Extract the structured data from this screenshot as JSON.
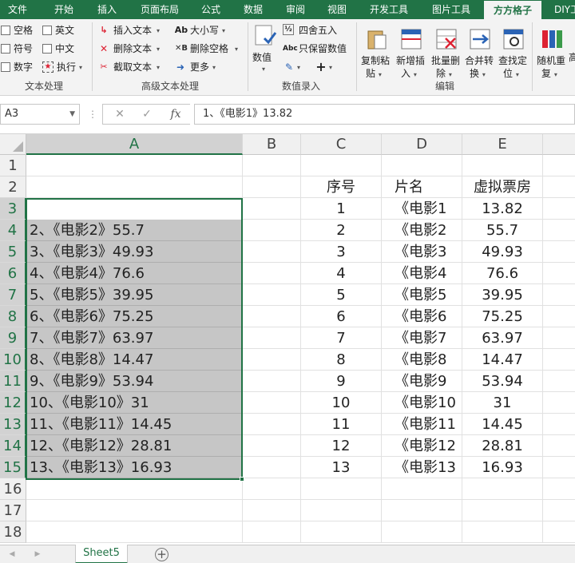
{
  "ribbon_tabs": [
    {
      "label": "文件"
    },
    {
      "label": "开始"
    },
    {
      "label": "插入"
    },
    {
      "label": "页面布局"
    },
    {
      "label": "公式"
    },
    {
      "label": "数据"
    },
    {
      "label": "审阅"
    },
    {
      "label": "视图"
    },
    {
      "label": "开发工具"
    },
    {
      "label": "图片工具"
    },
    {
      "label": "方方格子"
    },
    {
      "label": "DIY工"
    }
  ],
  "active_tab": "方方格子",
  "ribbon": {
    "text_processing": {
      "options": [
        "空格",
        "英文",
        "符号",
        "中文",
        "数字"
      ],
      "execute_label": "执行",
      "group_label": "文本处理"
    },
    "advanced_text": {
      "insert_text": "插入文本",
      "delete_text": "删除文本",
      "extract_text": "截取文本",
      "case_label": "大小写",
      "delete_spaces": "删除空格",
      "more": "更多",
      "group_label": "高级文本处理"
    },
    "numeric_entry": {
      "value_label": "数值",
      "round_label": "四舍五入",
      "keep_values": "只保留数值",
      "group_label": "数值录入"
    },
    "editing": {
      "buttons": [
        {
          "line1": "复制粘",
          "line2": "贴"
        },
        {
          "line1": "新增插",
          "line2": "入"
        },
        {
          "line1": "批量删",
          "line2": "除"
        },
        {
          "line1": "合并转",
          "line2": "换"
        },
        {
          "line1": "查找定",
          "line2": "位"
        }
      ],
      "group_label": "编辑"
    },
    "random": {
      "line1": "随机重",
      "line2": "复"
    },
    "cut_label": "高"
  },
  "formula_bar": {
    "name_box": "A3",
    "cancel_symbol": "✕",
    "enter_symbol": "✓",
    "fx_symbol": "fx",
    "content": "1、《电影1》13.82"
  },
  "columns": [
    {
      "letter": "A"
    },
    {
      "letter": "B"
    },
    {
      "letter": "C"
    },
    {
      "letter": "D"
    },
    {
      "letter": "E"
    }
  ],
  "rows": [
    {
      "num": "1",
      "A": "",
      "C": "",
      "D": "",
      "E": ""
    },
    {
      "num": "2",
      "A": "",
      "C": "序号",
      "D": "片名",
      "E": "虚拟票房"
    },
    {
      "num": "3",
      "A": "1、《电影1》13.82",
      "C": "1",
      "D": "《电影1",
      "E": "13.82"
    },
    {
      "num": "4",
      "A": "2、《电影2》55.7",
      "C": "2",
      "D": "《电影2",
      "E": "55.7"
    },
    {
      "num": "5",
      "A": "3、《电影3》49.93",
      "C": "3",
      "D": "《电影3",
      "E": "49.93"
    },
    {
      "num": "6",
      "A": "4、《电影4》76.6",
      "C": "4",
      "D": "《电影4",
      "E": "76.6"
    },
    {
      "num": "7",
      "A": "5、《电影5》39.95",
      "C": "5",
      "D": "《电影5",
      "E": "39.95"
    },
    {
      "num": "8",
      "A": "6、《电影6》75.25",
      "C": "6",
      "D": "《电影6",
      "E": "75.25"
    },
    {
      "num": "9",
      "A": "7、《电影7》63.97",
      "C": "7",
      "D": "《电影7",
      "E": "63.97"
    },
    {
      "num": "10",
      "A": "8、《电影8》14.47",
      "C": "8",
      "D": "《电影8",
      "E": "14.47"
    },
    {
      "num": "11",
      "A": "9、《电影9》53.94",
      "C": "9",
      "D": "《电影9",
      "E": "53.94"
    },
    {
      "num": "12",
      "A": "10、《电影10》31",
      "C": "10",
      "D": "《电影10",
      "E": "31"
    },
    {
      "num": "13",
      "A": "11、《电影11》14.45",
      "C": "11",
      "D": "《电影11",
      "E": "14.45"
    },
    {
      "num": "14",
      "A": "12、《电影12》28.81",
      "C": "12",
      "D": "《电影12",
      "E": "28.81"
    },
    {
      "num": "15",
      "A": "13、《电影13》16.93",
      "C": "13",
      "D": "《电影13",
      "E": "16.93"
    },
    {
      "num": "16",
      "A": "",
      "C": "",
      "D": "",
      "E": ""
    },
    {
      "num": "17",
      "A": "",
      "C": "",
      "D": "",
      "E": ""
    },
    {
      "num": "18",
      "A": "",
      "C": "",
      "D": "",
      "E": ""
    }
  ],
  "sheet_tabs": [
    {
      "label": "Sheet5"
    }
  ],
  "add_sheet_symbol": "+",
  "colors": {
    "accent": "#217346",
    "selection": "#c6c6c6"
  }
}
